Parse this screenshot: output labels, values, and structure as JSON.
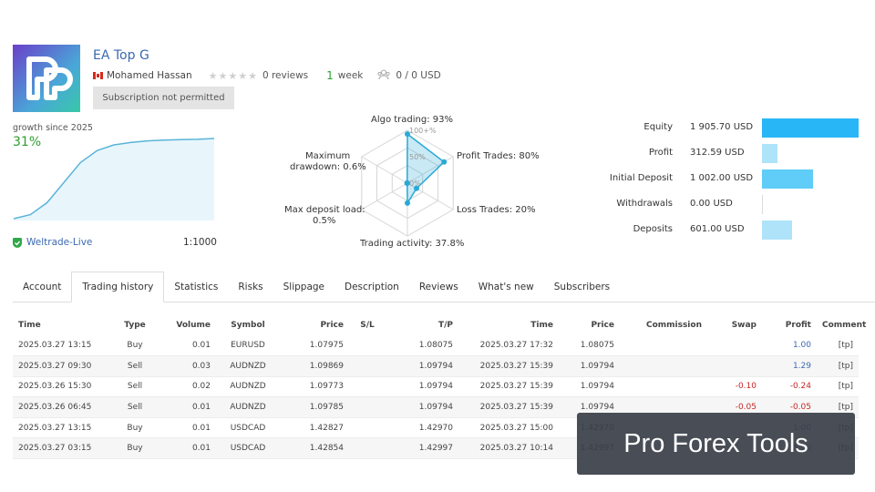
{
  "header": {
    "logo_letters": "FP",
    "title": "EA Top G",
    "author": "Mohamed Hassan",
    "stars": "★★★★★",
    "reviews": "0 reviews",
    "weeks_num": "1",
    "weeks_txt": "week",
    "subscribers": "0 / 0 USD",
    "subscription_button": "Subscription not permitted"
  },
  "growth": {
    "label": "growth since 2025",
    "value": "31%",
    "broker": "Weltrade-Live",
    "leverage": "1:1000",
    "curve_fraction": [
      0.0,
      0.05,
      0.2,
      0.45,
      0.7,
      0.85,
      0.92,
      0.95,
      0.97,
      0.98,
      0.985,
      0.99,
      1.0
    ]
  },
  "radar": {
    "algo": "Algo trading: 93%",
    "profit_trades": "Profit Trades: 80%",
    "loss_trades": "Loss Trades: 20%",
    "trading_activity": "Trading activity: 37.8%",
    "max_deposit_load": "Max deposit load:",
    "max_deposit_load_val": "0.5%",
    "max_drawdown": "Maximum",
    "max_drawdown_2": "drawdown: 0.6%",
    "grid_100": "100+%",
    "grid_50": "50%",
    "grid_0": "0%",
    "values": [
      93,
      80,
      20,
      37.8,
      0.5,
      0.6
    ]
  },
  "equity": {
    "rows": [
      {
        "label": "Equity",
        "value": "1 905.70 USD",
        "amount": 1905.7,
        "color": "#29b6f6"
      },
      {
        "label": "Profit",
        "value": "312.59 USD",
        "amount": 312.59,
        "color": "#aee3fa"
      },
      {
        "label": "Initial Deposit",
        "value": "1 002.00 USD",
        "amount": 1002.0,
        "color": "#5fcdf7"
      },
      {
        "label": "Withdrawals",
        "value": "0.00 USD",
        "amount": 0,
        "color": "#aee3fa"
      },
      {
        "label": "Deposits",
        "value": "601.00 USD",
        "amount": 601.0,
        "color": "#aee3fa"
      }
    ]
  },
  "tabs": [
    {
      "label": "Account"
    },
    {
      "label": "Trading history",
      "active": true
    },
    {
      "label": "Statistics"
    },
    {
      "label": "Risks"
    },
    {
      "label": "Slippage"
    },
    {
      "label": "Description"
    },
    {
      "label": "Reviews"
    },
    {
      "label": "What's new"
    },
    {
      "label": "Subscribers"
    }
  ],
  "table": {
    "headers": [
      "Time",
      "Type",
      "Volume",
      "Symbol",
      "Price",
      "S/L",
      "T/P",
      "Time",
      "Price",
      "Commission",
      "Swap",
      "Profit",
      "Comment"
    ],
    "rows": [
      [
        "2025.03.27 13:15",
        "Buy",
        "0.01",
        "EURUSD",
        "1.07975",
        "",
        "1.08075",
        "2025.03.27 17:32",
        "1.08075",
        "",
        "",
        "1.00",
        "[tp]"
      ],
      [
        "2025.03.27 09:30",
        "Sell",
        "0.03",
        "AUDNZD",
        "1.09869",
        "",
        "1.09794",
        "2025.03.27 15:39",
        "1.09794",
        "",
        "",
        "1.29",
        "[tp]"
      ],
      [
        "2025.03.26 15:30",
        "Sell",
        "0.02",
        "AUDNZD",
        "1.09773",
        "",
        "1.09794",
        "2025.03.27 15:39",
        "1.09794",
        "",
        "-0.10",
        "-0.24",
        "[tp]"
      ],
      [
        "2025.03.26 06:45",
        "Sell",
        "0.01",
        "AUDNZD",
        "1.09785",
        "",
        "1.09794",
        "2025.03.27 15:39",
        "1.09794",
        "",
        "-0.05",
        "-0.05",
        "[tp]"
      ],
      [
        "2025.03.27 13:15",
        "Buy",
        "0.01",
        "USDCAD",
        "1.42827",
        "",
        "1.42970",
        "2025.03.27 15:00",
        "1.42970",
        "",
        "",
        "1.00",
        "[tp]"
      ],
      [
        "2025.03.27 03:15",
        "Buy",
        "0.01",
        "USDCAD",
        "1.42854",
        "",
        "1.42997",
        "2025.03.27 10:14",
        "1.42997",
        "",
        "",
        "1.00",
        "[tp]"
      ]
    ]
  },
  "watermark": "Pro Forex Tools",
  "colors": {
    "accent": "#3b6ab0",
    "positive": "#2e9e2e",
    "negative": "#c62828",
    "radar_stroke": "#29a9d6"
  }
}
